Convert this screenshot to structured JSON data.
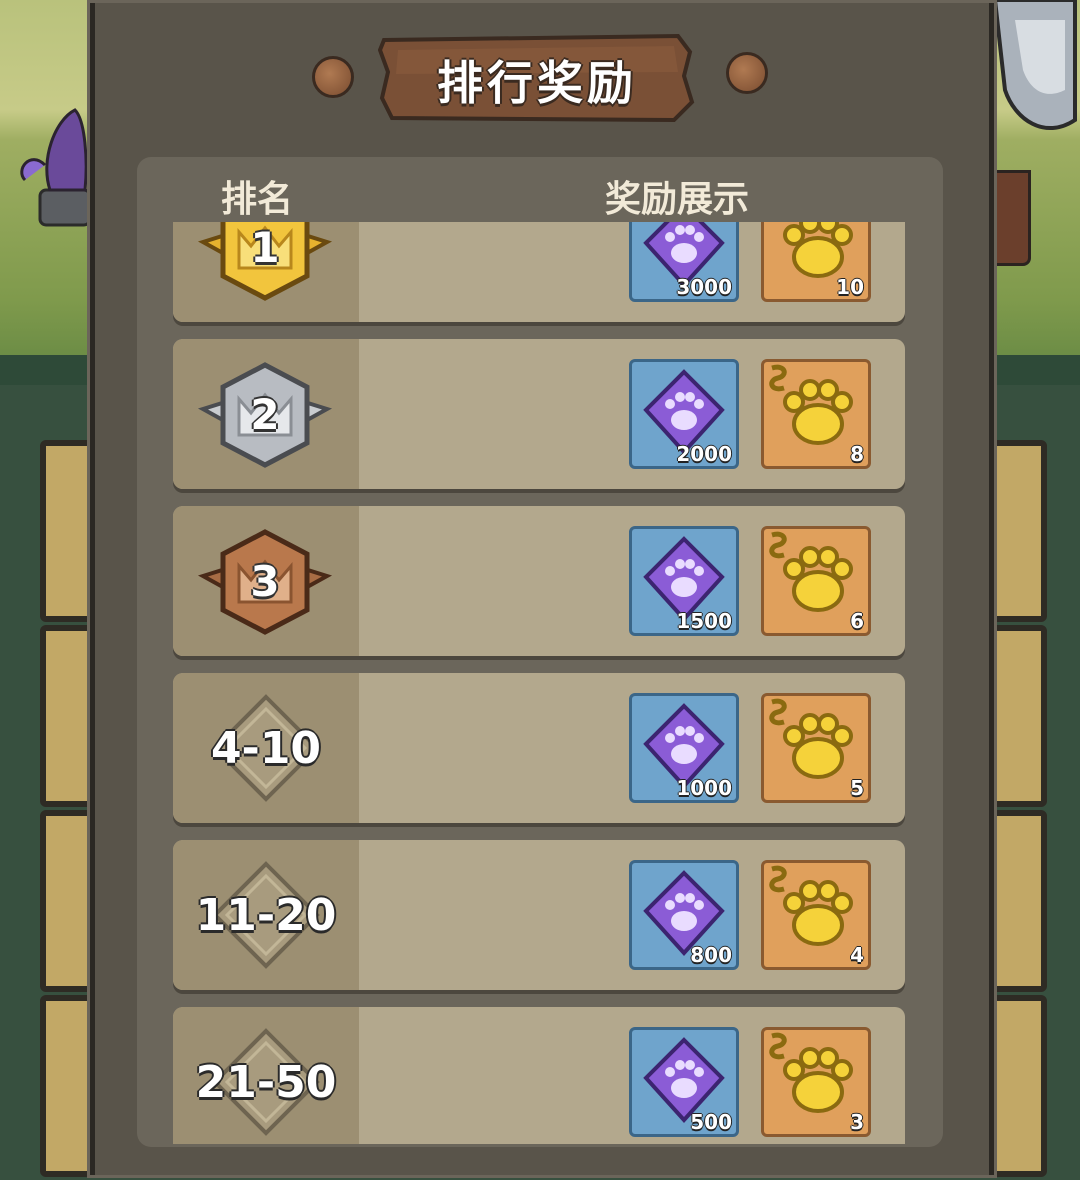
{
  "dialog": {
    "title": "排行奖励",
    "header_rank": "排名",
    "header_rewards": "奖励展示"
  },
  "rows": [
    {
      "rank": "1",
      "medal": "gold",
      "gem_qty": "3000",
      "paw_qty": "10"
    },
    {
      "rank": "2",
      "medal": "silver",
      "gem_qty": "2000",
      "paw_qty": "8"
    },
    {
      "rank": "3",
      "medal": "bronze",
      "gem_qty": "1500",
      "paw_qty": "6"
    },
    {
      "rank": "4-10",
      "medal": "none",
      "gem_qty": "1000",
      "paw_qty": "5"
    },
    {
      "rank": "11-20",
      "medal": "none",
      "gem_qty": "800",
      "paw_qty": "4"
    },
    {
      "rank": "21-50",
      "medal": "none",
      "gem_qty": "500",
      "paw_qty": "3"
    }
  ],
  "colors": {
    "gold": "#f2c53d",
    "silver": "#c9ccd0",
    "bronze": "#a86c44",
    "gem": "#8b5cd6",
    "paw": "#f5d23a"
  },
  "icons": {
    "gem_item": "purple-paw-gem-icon",
    "paw_item": "gold-s-paw-icon",
    "rank_badge": "diamond-badge-icon"
  }
}
